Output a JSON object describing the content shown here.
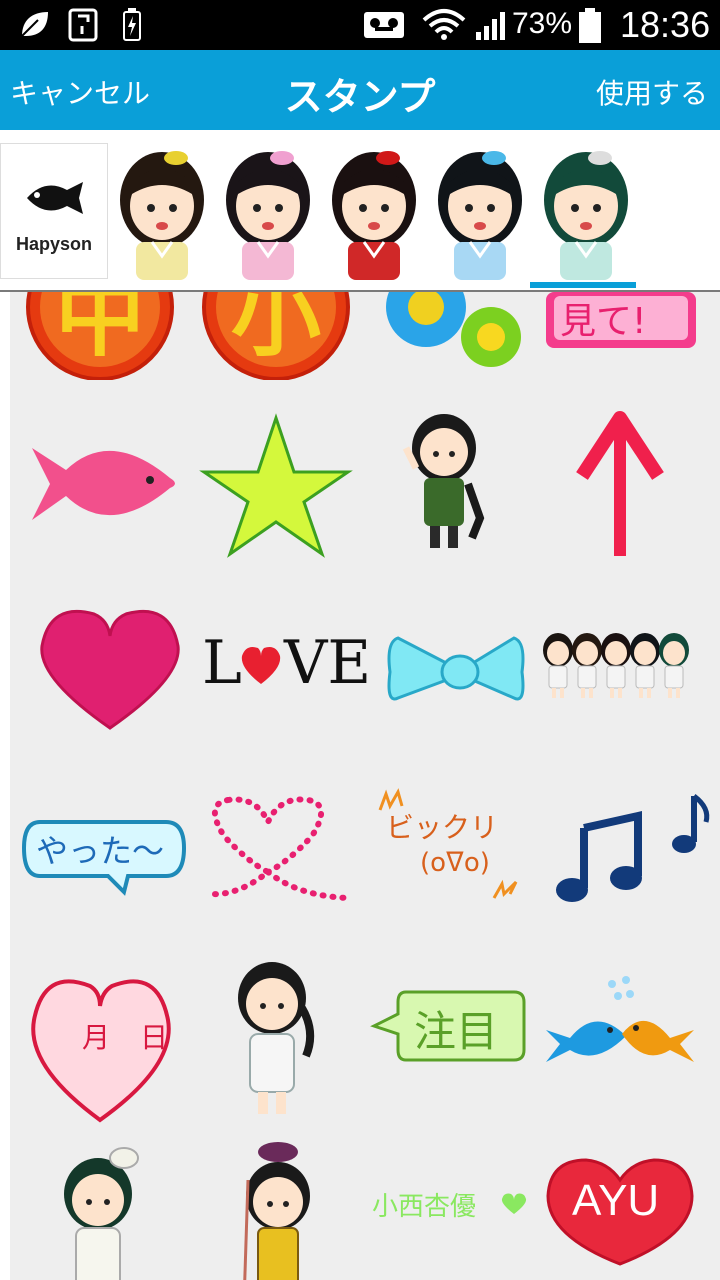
{
  "status_bar": {
    "battery": "73%",
    "time": "18:36"
  },
  "header": {
    "cancel_label": "キャンセル",
    "title": "スタンプ",
    "use_label": "使用する"
  },
  "tabs": {
    "logo_text": "Hapyson",
    "characters": [
      "character-1",
      "character-2",
      "character-3",
      "character-4",
      "character-5"
    ],
    "selected_index": 5
  },
  "stamps": {
    "row0": [
      "",
      "",
      "",
      "見て!"
    ],
    "love_text_l": "L",
    "love_text_ve": "VE",
    "yatta": "やった〜",
    "bikkuri": "ビックリ",
    "bikkuri_face": "(oᐁo)",
    "calendar_month": "月",
    "calendar_day": "日",
    "chuumoku": "注目",
    "name_text": "小西杏優",
    "ayu": "AYU"
  },
  "colors": {
    "header_bg": "#0a9fd8",
    "grid_bg": "#eeeeee"
  }
}
